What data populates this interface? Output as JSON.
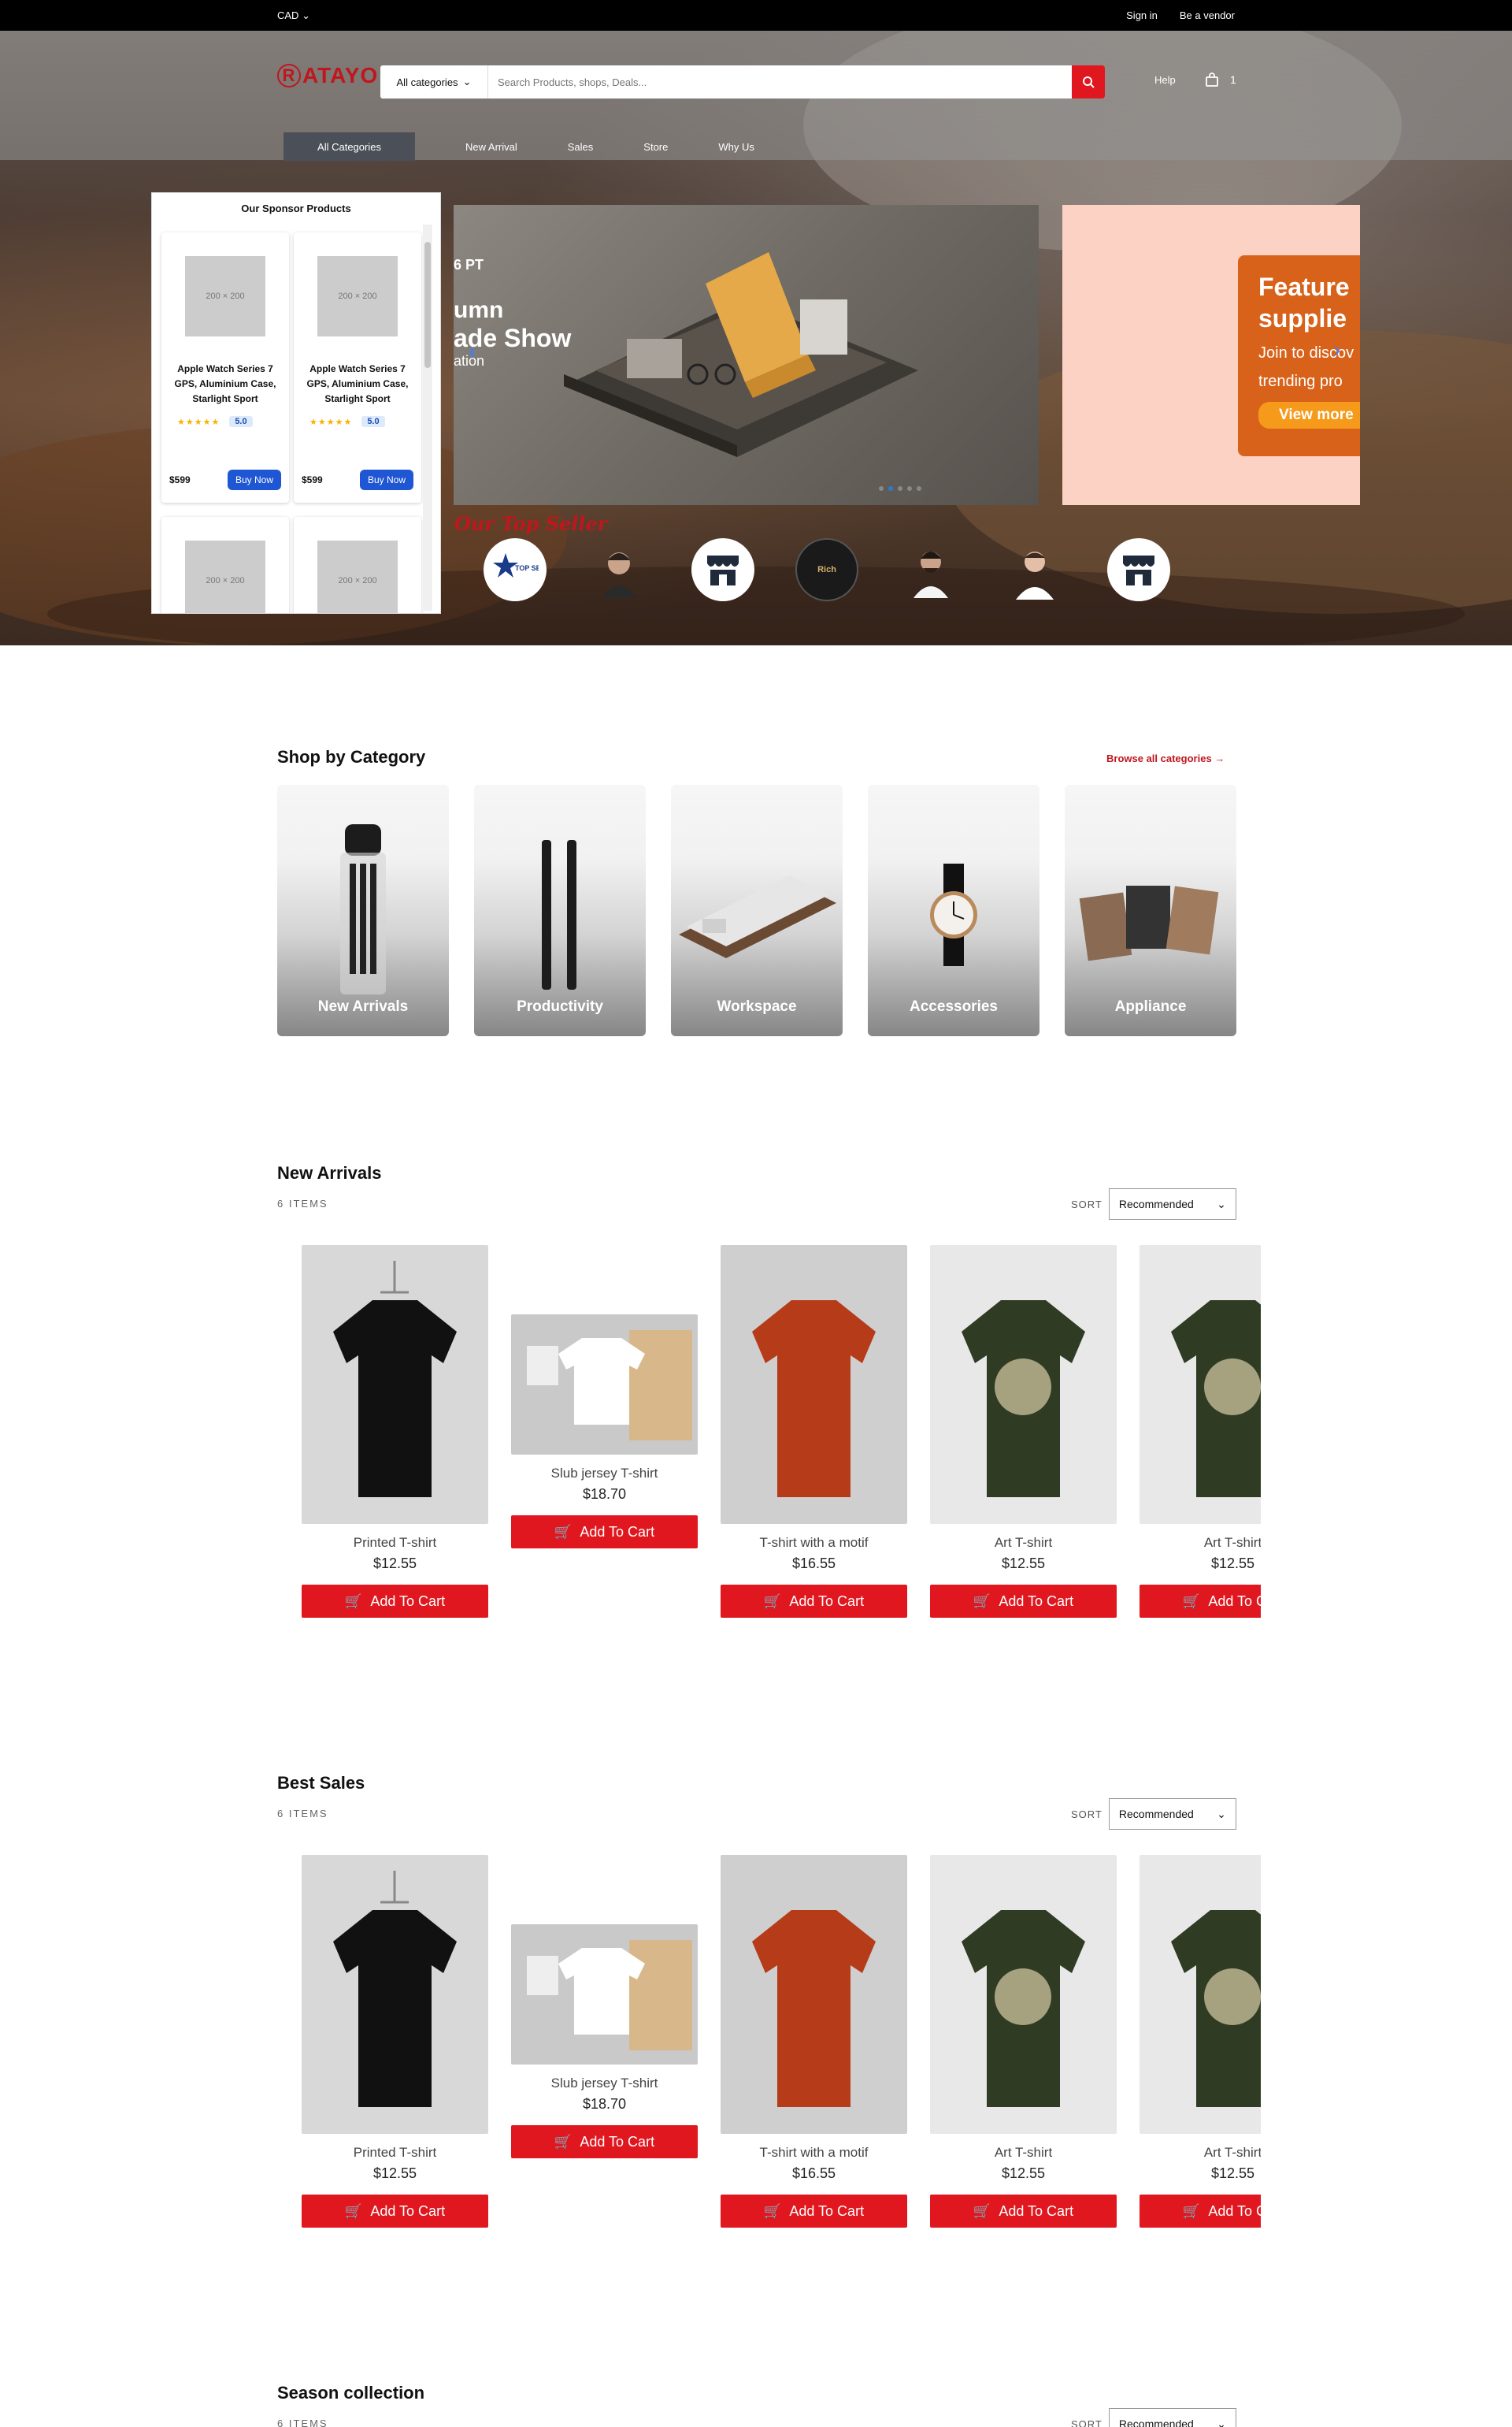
{
  "topbar": {
    "currency": "CAD",
    "sign_in": "Sign in",
    "vendor": "Be a vendor"
  },
  "header": {
    "logo": "ATAYO",
    "logo_letter": "R",
    "search_category": "All categories",
    "search_placeholder": "Search Products, shops, Deals...",
    "help": "Help",
    "cart_count": "1"
  },
  "nav": {
    "all_categories": "All Categories",
    "items": [
      "New Arrival",
      "Sales",
      "Store",
      "Why Us"
    ]
  },
  "sponsor": {
    "title": "Our Sponsor Products",
    "products": [
      {
        "img": "200 × 200",
        "name": "Apple Watch Series 7 GPS, Aluminium Case, Starlight Sport",
        "rating": "5.0",
        "price": "$599",
        "button": "Buy Now"
      },
      {
        "img": "200 × 200",
        "name": "Apple Watch Series 7 GPS, Aluminium Case, Starlight Sport",
        "rating": "5.0",
        "price": "$599",
        "button": "Buy Now"
      },
      {
        "img": "200 × 200"
      },
      {
        "img": "200 × 200"
      }
    ]
  },
  "banner": {
    "line1": "6 PT",
    "line2": "umn",
    "line3": "ade Show",
    "line4": "ation"
  },
  "promo": {
    "title1": "Feature",
    "title2": "supplie",
    "sub1": "Join to discov",
    "sub2": "trending pro",
    "cta": "View more"
  },
  "top_seller": {
    "title": "Our Top Seller",
    "badge_text": "TOP SELLER",
    "rich_text": "Rich"
  },
  "shop_by_category": {
    "title": "Shop by Category",
    "browse": "Browse all categories →",
    "categories": [
      "New Arrivals",
      "Productivity",
      "Workspace",
      "Accessories",
      "Appliance"
    ]
  },
  "new_arrivals": {
    "title": "New Arrivals",
    "count": "6 ITEMS",
    "sort_label": "SORT",
    "sort_value": "Recommended",
    "products": [
      {
        "name": "Printed T-shirt",
        "price": "$12.55",
        "button": "Add To Cart"
      },
      {
        "name": "Slub jersey T-shirt",
        "price": "$18.70",
        "button": "Add To Cart"
      },
      {
        "name": "T-shirt with a motif",
        "price": "$16.55",
        "button": "Add To Cart"
      },
      {
        "name": "Art T-shirt",
        "price": "$12.55",
        "button": "Add To Cart"
      },
      {
        "name": "Art T-shirt",
        "price": "$12.55",
        "button": "Add To Cart"
      }
    ]
  },
  "best_sales": {
    "title": "Best Sales",
    "count": "6 ITEMS",
    "sort_label": "SORT",
    "sort_value": "Recommended",
    "products": [
      {
        "name": "Printed T-shirt",
        "price": "$12.55",
        "button": "Add To Cart"
      },
      {
        "name": "Slub jersey T-shirt",
        "price": "$18.70",
        "button": "Add To Cart"
      },
      {
        "name": "T-shirt with a motif",
        "price": "$16.55",
        "button": "Add To Cart"
      },
      {
        "name": "Art T-shirt",
        "price": "$12.55",
        "button": "Add To Cart"
      },
      {
        "name": "Art T-shirt",
        "price": "$12.55",
        "button": "Add To Cart"
      }
    ]
  },
  "season": {
    "title": "Season collection",
    "count": "6 ITEMS",
    "sort_label": "SORT",
    "sort_value": "Recommended"
  },
  "colors": {
    "brand_red": "#e0171f",
    "buy_blue": "#1f56d4",
    "accent_orange": "#d9621a"
  }
}
